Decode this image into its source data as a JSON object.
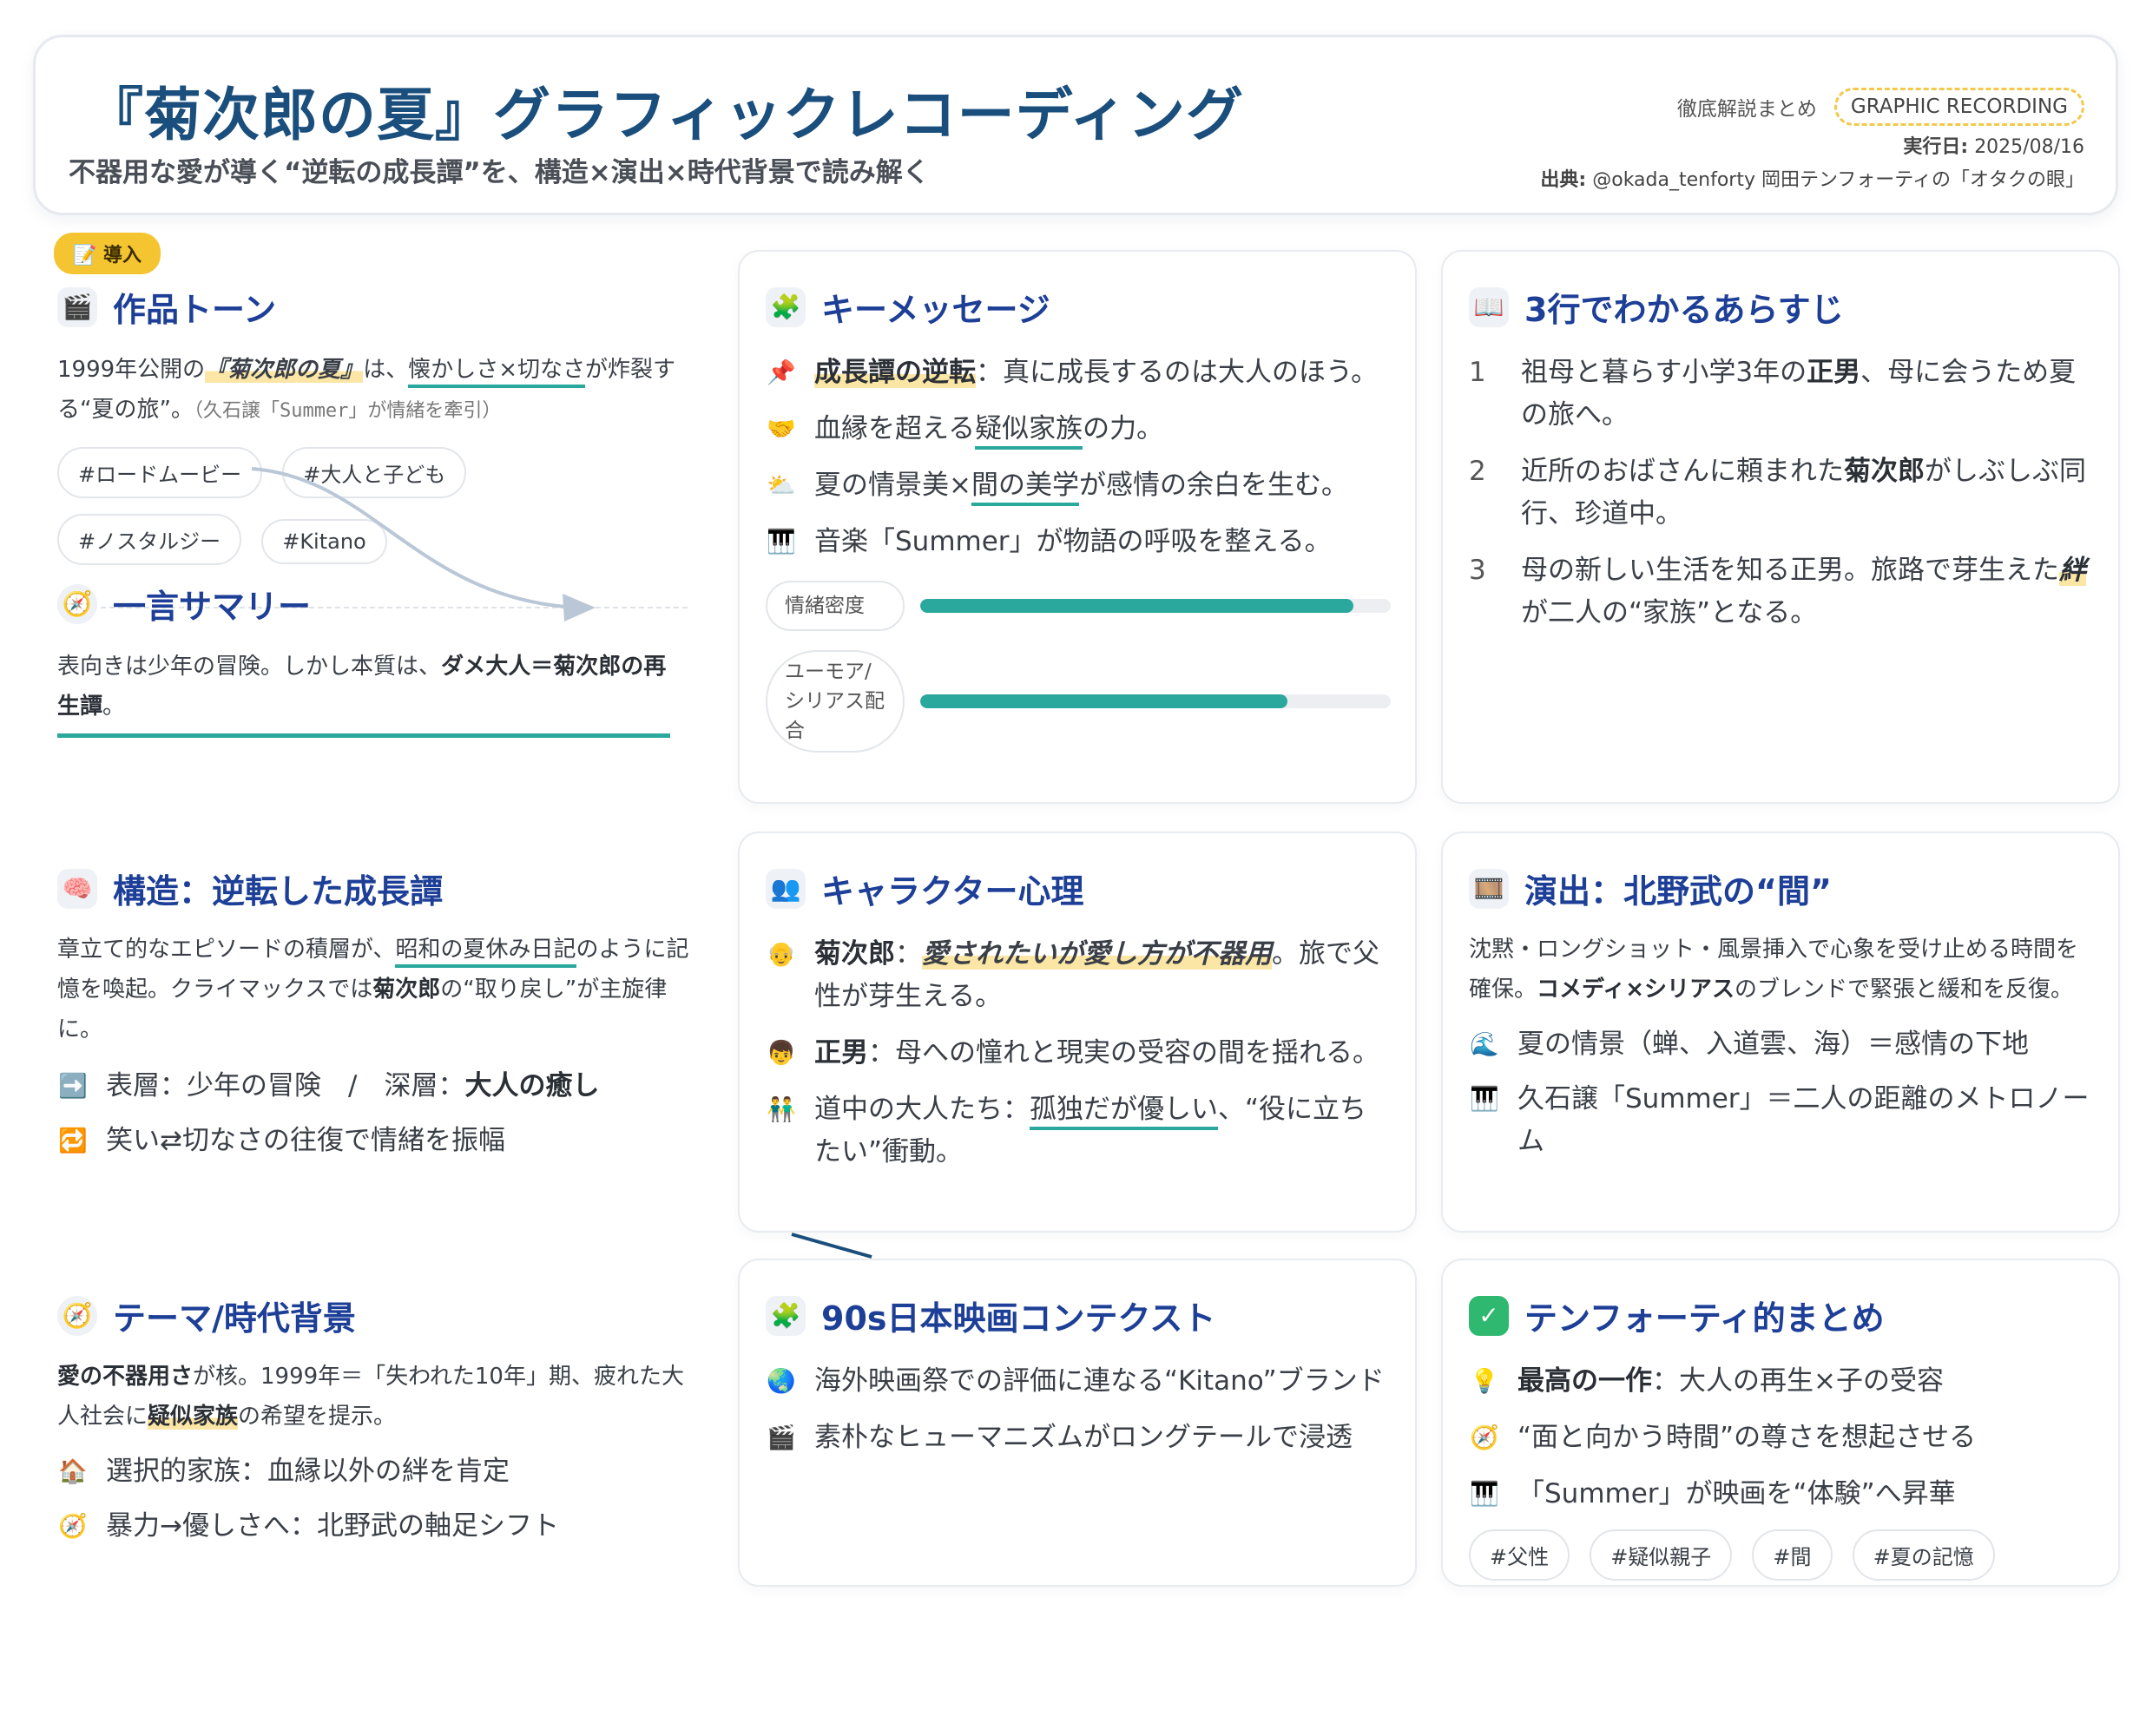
{
  "header": {
    "title": "『菊次郎の夏』グラフィックレコーディング",
    "subtitle": "不器用な愛が導く“逆転の成長譚”を、構造×演出×時代背景で読み解く",
    "kicker": "徹底解説まとめ",
    "chip": "GRAPHIC RECORDING",
    "date_label": "実行日:",
    "date": "2025/08/16",
    "source_label": "出典:",
    "source": "@okada_tenforty 岡田テンフォーティの「オタクの眼」"
  },
  "intro": {
    "badge": "📝 導入",
    "tone": {
      "icon": "clapperboard-icon",
      "title": "作品トーン",
      "p1": "1999年公開の",
      "p_title": "『菊次郎の夏』",
      "p2": "は、",
      "p_ul": "懐かしさ×切なさ",
      "p3": "が炸裂する“夏の旅”。",
      "p_note": "（久石譲「Summer」が情緒を牽引）",
      "tags": [
        "#ロードムービー",
        "#大人と子ども",
        "#ノスタルジー",
        "#Kitano"
      ]
    },
    "summary": {
      "icon": "compass-icon",
      "title": "一言サマリー",
      "p1": "表向きは少年の冒険。しかし本質は、",
      "p_bold": "ダメ大人＝菊次郎の再生譚",
      "p2": "。"
    }
  },
  "key_message": {
    "icon": "puzzle-icon",
    "title": "キーメッセージ",
    "items": [
      {
        "icon": "📌",
        "bold": "成長譚の逆転",
        "text": "：真に成長するのは大人のほう。"
      },
      {
        "icon": "🤝",
        "pre": "血縁を超える",
        "ul": "疑似家族",
        "text": "の力。"
      },
      {
        "icon": "⛅",
        "pre": "夏の情景美×",
        "ul": "間の美学",
        "text": "が感情の余白を生む。"
      },
      {
        "icon": "🎹",
        "pre": "音楽「Summer」が物語の呼吸を整える。",
        "ul": "",
        "text": ""
      }
    ],
    "meters": [
      {
        "label": "情緒密度",
        "value": 0.92
      },
      {
        "label": "ユーモア/シリアス配合",
        "value": 0.78
      }
    ]
  },
  "synopsis": {
    "icon": "book-icon",
    "title": "3行でわかるあらすじ",
    "items": [
      {
        "num": "1",
        "pre": "祖母と暮らす小学3年の",
        "bold": "正男",
        "post": "、母に会うため夏の旅へ。"
      },
      {
        "num": "2",
        "pre": "近所のおばさんに頼まれた",
        "bold": "菊次郎",
        "post": "がしぶしぶ同行、珍道中。"
      },
      {
        "num": "3",
        "pre": "母の新しい生活を知る正男。旅路で芽生えた",
        "bold": "絆",
        "post": "が二人の“家族”となる。"
      }
    ]
  },
  "structure": {
    "icon": "brain-icon",
    "title": "構造：逆転した成長譚",
    "p1": "章立て的なエピソードの積層が、",
    "p_ul": "昭和の夏休み日記",
    "p2": "のように記憶を喚起。クライマックスでは",
    "p_bold": "菊次郎",
    "p3": "の“取り戻し”が主旋律に。",
    "items": [
      {
        "icon": "➡️",
        "pre": "表層：少年の冒険　/　深層：",
        "bold": "大人の癒し"
      },
      {
        "icon": "🔁",
        "pre": "笑い⇄切なさの往復で情緒を振幅",
        "bold": ""
      }
    ]
  },
  "character": {
    "icon": "people-icon",
    "title": "キャラクター心理",
    "items": [
      {
        "icon": "👴",
        "bold": "菊次郎",
        "mid": "：",
        "em": "愛されたいが愛し方が不器用",
        "post": "。旅で父性が芽生える。"
      },
      {
        "icon": "👦",
        "bold": "正男",
        "mid": "：母への憧れと現実の受容の間を揺れる。",
        "em": "",
        "post": ""
      },
      {
        "icon": "👬",
        "bold": "",
        "mid": "道中の大人たち：",
        "ul": "孤独だが優しい",
        "post": "、“役に立ちたい”衝動。"
      }
    ]
  },
  "direction": {
    "icon": "film-icon",
    "title": "演出：北野武の“間”",
    "p1": "沈黙・ロングショット・風景挿入で心象を受け止める時間を確保。",
    "p_bold": "コメディ×シリアス",
    "p2": "のブレンドで緊張と緩和を反復。",
    "items": [
      {
        "icon": "🌊",
        "text": "夏の情景（蝉、入道雲、海）＝感情の下地"
      },
      {
        "icon": "🎹",
        "text": "久石譲「Summer」＝二人の距離のメトロノーム"
      }
    ]
  },
  "theme": {
    "icon": "compass-icon",
    "title": "テーマ/時代背景",
    "p_bold": "愛の不器用さ",
    "p1": "が核。1999年＝「失われた10年」期、疲れた大人社会に",
    "p_hl": "疑似家族",
    "p2": "の希望を提示。",
    "items": [
      {
        "icon": "🏠",
        "text": "選択的家族：血縁以外の絆を肯定"
      },
      {
        "icon": "🧭",
        "text": "暴力→優しさへ：北野武の軸足シフト"
      }
    ]
  },
  "context90s": {
    "icon": "puzzle-icon",
    "title": "90s日本映画コンテクスト",
    "items": [
      {
        "icon": "🌏",
        "text": "海外映画祭での評価に連なる“Kitano”ブランド"
      },
      {
        "icon": "🎬",
        "text": "素朴なヒューマニズムがロングテールで浸透"
      }
    ]
  },
  "conclusion": {
    "icon": "check-icon",
    "title": "テンフォーティ的まとめ",
    "items": [
      {
        "icon": "💡",
        "bold": "最高の一作",
        "text": "：大人の再生×子の受容"
      },
      {
        "icon": "🧭",
        "bold": "",
        "text": "“面と向かう時間”の尊さを想起させる"
      },
      {
        "icon": "🎹",
        "bold": "",
        "text": "「Summer」が映画を“体験”へ昇華"
      }
    ],
    "tags": [
      "#父性",
      "#疑似親子",
      "#間",
      "#夏の記憶"
    ]
  },
  "colors": {
    "title": "#1a4e7c",
    "section": "#1d3f97",
    "accent": "#2aa89d",
    "highlight": "#fbe6a6",
    "badge": "#f5c431"
  }
}
